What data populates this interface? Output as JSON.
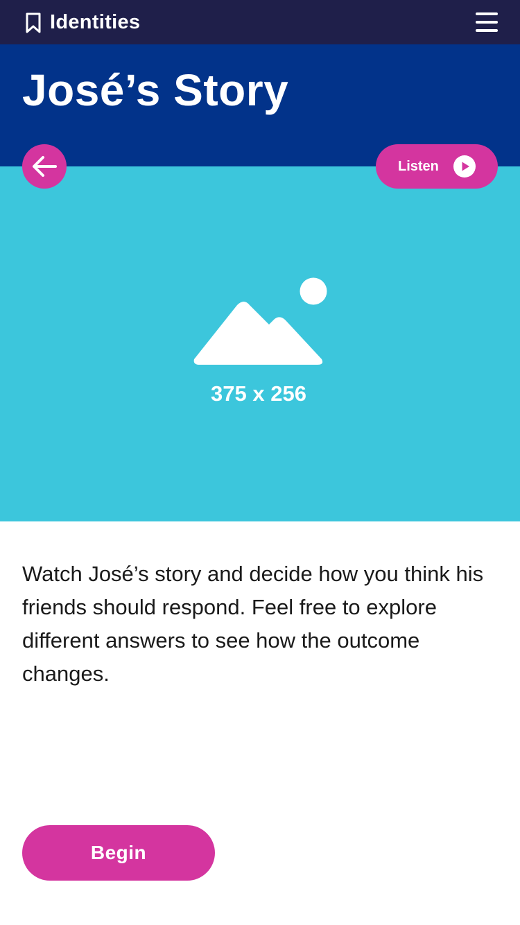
{
  "topbar": {
    "section_title": "Identities",
    "bookmark_icon": "bookmark-icon",
    "menu_icon": "hamburger-menu-icon"
  },
  "header": {
    "title": "José’s Story"
  },
  "controls": {
    "back_icon": "arrow-left-icon",
    "listen_label": "Listen",
    "listen_icon": "play-icon"
  },
  "hero": {
    "placeholder_icon": "image-placeholder-icon",
    "size_label": "375 x 256"
  },
  "body": {
    "description": "Watch José’s story and decide how you think his friends should respond. Feel free to explore different answers to see how the outcome changes."
  },
  "actions": {
    "begin_label": "Begin"
  },
  "colors": {
    "topbar": "#1f1f4a",
    "header": "#02338a",
    "hero": "#3cc6dc",
    "accent": "#d4359f",
    "text": "#1a1a1a"
  }
}
